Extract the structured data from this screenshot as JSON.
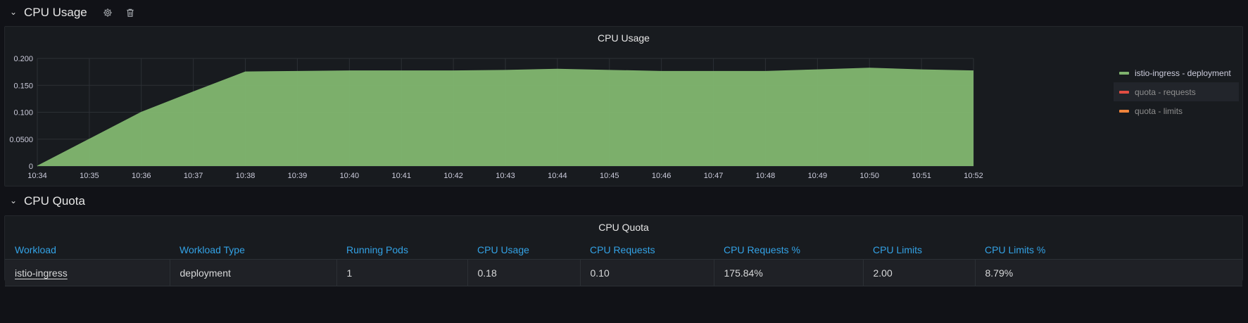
{
  "rows": {
    "usage": {
      "title": "CPU Usage"
    },
    "quota": {
      "title": "CPU Quota"
    }
  },
  "icons": {
    "settings": "gear-icon",
    "delete": "trash-icon",
    "collapse": "chevron-down-icon"
  },
  "usage_panel": {
    "title": "CPU Usage"
  },
  "legend": [
    {
      "label": "istio-ingress - deployment",
      "color": "#7eb26d"
    },
    {
      "label": "quota - requests",
      "color": "#e24d42"
    },
    {
      "label": "quota - limits",
      "color": "#ef843c"
    }
  ],
  "chart_data": {
    "type": "area",
    "title": "CPU Usage",
    "xlabel": "",
    "ylabel": "",
    "x": [
      "10:34",
      "10:35",
      "10:36",
      "10:37",
      "10:38",
      "10:39",
      "10:40",
      "10:41",
      "10:42",
      "10:43",
      "10:44",
      "10:45",
      "10:46",
      "10:47",
      "10:48",
      "10:49",
      "10:50",
      "10:51",
      "10:52"
    ],
    "series": [
      {
        "name": "istio-ingress - deployment",
        "color": "#7eb26d",
        "values": [
          0,
          0.05,
          0.1,
          0.138,
          0.175,
          0.176,
          0.177,
          0.177,
          0.177,
          0.178,
          0.18,
          0.178,
          0.176,
          0.176,
          0.176,
          0.179,
          0.182,
          0.179,
          0.177
        ]
      }
    ],
    "yticks": [
      "0",
      "0.0500",
      "0.100",
      "0.150",
      "0.200"
    ],
    "ytick_values": [
      0,
      0.05,
      0.1,
      0.15,
      0.2
    ],
    "ylim": [
      0,
      0.2
    ],
    "grid": true,
    "legend_position": "right"
  },
  "quota_panel": {
    "title": "CPU Quota",
    "columns": [
      "Workload",
      "Workload Type",
      "Running Pods",
      "CPU Usage",
      "CPU Requests",
      "CPU Requests %",
      "CPU Limits",
      "CPU Limits %"
    ],
    "rows": [
      [
        "istio-ingress",
        "deployment",
        "1",
        "0.18",
        "0.10",
        "175.84%",
        "2.00",
        "8.79%"
      ]
    ]
  }
}
